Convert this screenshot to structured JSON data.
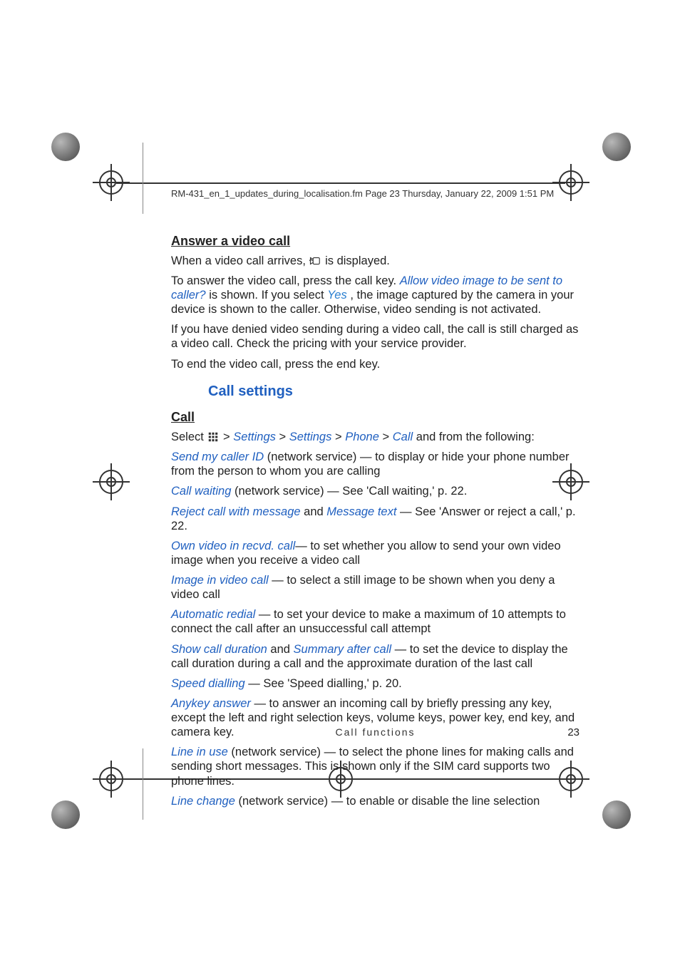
{
  "header": "RM-431_en_1_updates_during_localisation.fm  Page 23  Thursday, January 22, 2009  1:51 PM",
  "headings": {
    "answer": "Answer a video call",
    "callsettings": "Call settings",
    "call": "Call"
  },
  "p1a": "When a video call arrives, ",
  "p1b": " is displayed.",
  "p2a": "To answer the video call, press the call key. ",
  "p2b": "Allow video image to be sent to caller?",
  "p2c": " is shown. If you select ",
  "p2d": "Yes",
  "p2e": ", the image captured by the camera in your device is shown to the caller. Otherwise, video sending is not activated.",
  "p3": "If you have denied video sending during a video call, the call is still charged as a video call. Check the pricing with your service provider.",
  "p4": "To end the video call, press the end key.",
  "nav": {
    "select": "Select ",
    "sep": " > ",
    "m1": "Settings",
    "m2": "Settings",
    "m3": "Phone",
    "m4": "Call",
    "after": " and from the following:"
  },
  "items": {
    "sendid_t": "Send my caller ID",
    "sendid_b": " (network service) — to display or hide your phone number from the person to whom you are calling",
    "wait_t": "Call waiting",
    "wait_b": " (network service) — See 'Call waiting,' p. 22.",
    "reject_t": "Reject call with message",
    "and": " and ",
    "msg_t": "Message text",
    "reject_b": " — See 'Answer or reject a call,' p. 22.",
    "own_t": "Own video in recvd. call",
    "own_b": "— to set whether you allow to send your own video image when you receive a video call",
    "img_t": "Image in video call",
    "img_b": " — to select a still image to be shown when you deny a video call",
    "auto_t": "Automatic redial",
    "auto_b": " — to set your device to make a maximum of 10 attempts to connect the call after an unsuccessful call attempt",
    "dur_t": "Show call duration",
    "sum_t": "Summary after call",
    "dur_b": " — to set the device to display the call duration during a call and the approximate duration of the last call",
    "speed_t": "Speed dialling",
    "speed_b": " — See 'Speed dialling,' p. 20.",
    "any_t": "Anykey answer",
    "any_b": " — to answer an incoming call by briefly pressing any key, except the left and right selection keys, volume keys, power key, end key, and camera key.",
    "line_t": "Line in use",
    "line_b": " (network service) — to select the phone lines for making calls and sending short messages. This is shown only if the SIM card supports two phone lines.",
    "lch_t": "Line change",
    "lch_b": " (network service) — to enable or disable the line selection"
  },
  "footer": "Call functions",
  "pagenum": "23"
}
